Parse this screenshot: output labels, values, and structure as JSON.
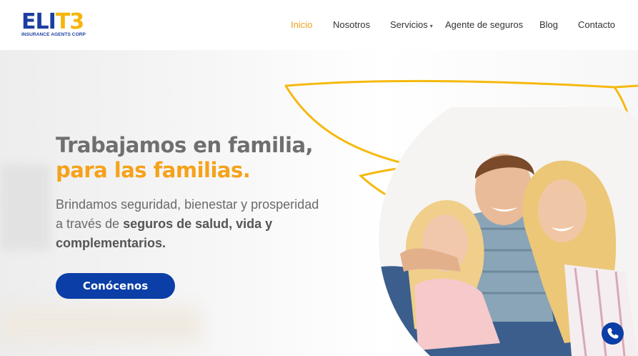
{
  "logo": {
    "mark_left": "ELI",
    "mark_right": "T3",
    "subtitle": "INSURANCE AGENTS CORP"
  },
  "nav": {
    "items": [
      {
        "label": "Inicio",
        "active": true
      },
      {
        "label": "Nosotros"
      },
      {
        "label": "Servicios",
        "has_dropdown": true
      },
      {
        "label": "Agente de seguros"
      },
      {
        "label": "Blog"
      },
      {
        "label": "Contacto"
      }
    ]
  },
  "hero": {
    "headline_line1": "Trabajamos en familia,",
    "headline_line2": "para las familias.",
    "sub_text_1": "Brindamos seguridad, bienestar y prosperidad a través de ",
    "sub_text_bold": "seguros de salud, vida y complementarios.",
    "cta_label": "Conócenos"
  },
  "colors": {
    "brand_blue": "#0b3ea6",
    "accent_orange": "#f5a21b",
    "nav_active": "#f0a11e"
  },
  "icons": {
    "whatsapp": "whatsapp-phone-icon",
    "dropdown": "caret-down-icon"
  }
}
